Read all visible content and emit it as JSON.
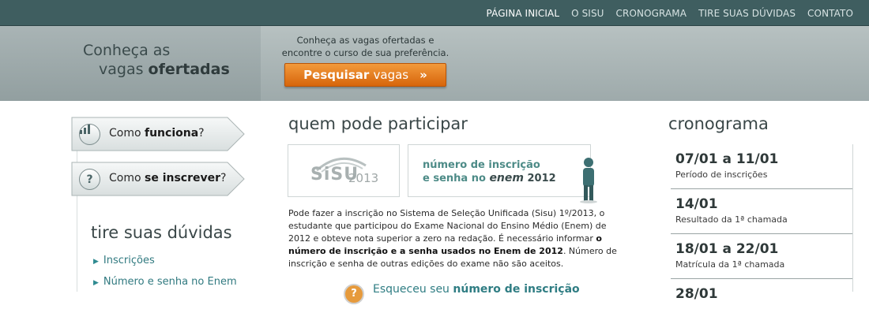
{
  "nav": {
    "items": [
      "PÁGINA INICIAL",
      "O SISU",
      "CRONOGRAMA",
      "TIRE SUAS DÚVIDAS",
      "CONTATO"
    ]
  },
  "banner": {
    "title_line1": "Conheça as",
    "title_line2_prefix": "vagas",
    "title_line2_bold": "ofertadas",
    "desc_line1": "Conheça as vagas ofertadas e",
    "desc_line2": "encontre o curso de sua preferência.",
    "search_bold": "Pesquisar",
    "search_rest": "vagas",
    "search_chevron": "»"
  },
  "sidebar": {
    "tab1_prefix": "Como",
    "tab1_bold": "funciona",
    "tab1_suffix": "?",
    "tab1_icon": "bar-chart-icon",
    "tab2_prefix": "Como",
    "tab2_bold": "se inscrever",
    "tab2_suffix": "?",
    "tab2_icon": "question-icon",
    "tab2_icon_glyph": "?",
    "help_title": "tire suas dúvidas",
    "links": [
      "Inscrições",
      "Número e senha no Enem"
    ]
  },
  "middle": {
    "title": "quem pode participar",
    "sisu_logo_text": "SiSU",
    "sisu_logo_year": "2013",
    "enem_line1": "número de inscrição",
    "enem_line2_prefix": "e senha no",
    "enem_word": "enem",
    "enem_year": "2012",
    "para_part1": "Pode fazer a inscrição no Sistema de Seleção Unificada (Sisu) 1º/2013, o estudante que participou do Exame Nacional do Ensino Médio (Enem) de 2012 e obteve nota superior a zero na redação. É necessário informar",
    "para_bold": "o número de inscrição e a senha usados no Enem de 2012",
    "para_part2": ". Número de inscrição e senha de outras edições do exame não são aceitos.",
    "forgot_prefix": "Esqueceu seu",
    "forgot_bold": "número de inscrição",
    "forgot_icon_glyph": "?"
  },
  "cronograma": {
    "title": "cronograma",
    "items": [
      {
        "date": "07/01 a 11/01",
        "desc": "Período de inscrições"
      },
      {
        "date": "14/01",
        "desc": "Resultado da 1ª chamada"
      },
      {
        "date": "18/01 a 22/01",
        "desc": "Matrícula da 1ª chamada"
      },
      {
        "date": "28/01",
        "desc": ""
      }
    ]
  },
  "colors": {
    "nav_bg": "#3f5e60",
    "accent_orange": "#e07a1f",
    "link_teal": "#317a80"
  }
}
